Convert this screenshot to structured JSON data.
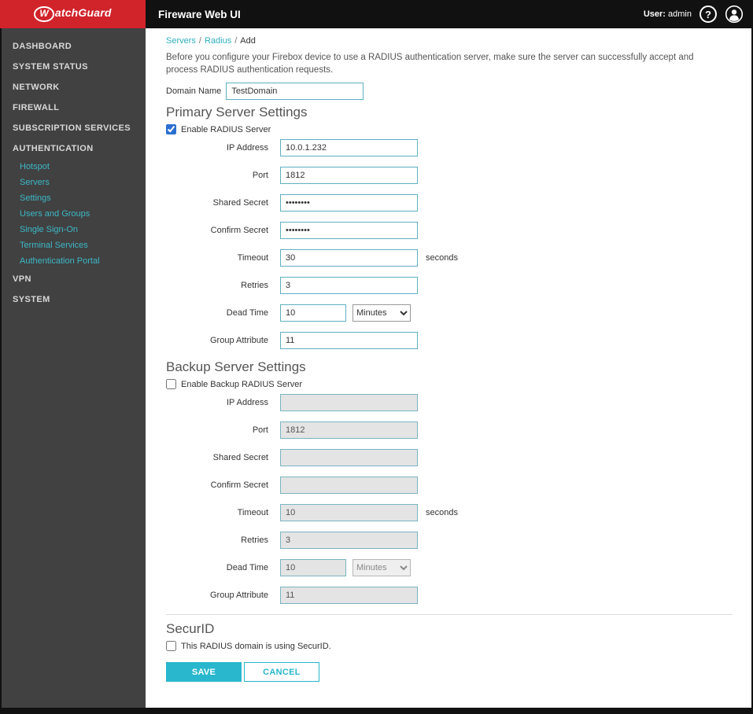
{
  "header": {
    "brand_w": "W",
    "brand_rest": "atchGuard",
    "app_title": "Fireware Web UI",
    "user_label": "User:",
    "user_name": "admin",
    "help_glyph": "?"
  },
  "sidebar": {
    "items": [
      {
        "label": "DASHBOARD"
      },
      {
        "label": "SYSTEM STATUS"
      },
      {
        "label": "NETWORK"
      },
      {
        "label": "FIREWALL"
      },
      {
        "label": "SUBSCRIPTION SERVICES"
      },
      {
        "label": "AUTHENTICATION"
      },
      {
        "label": "VPN"
      },
      {
        "label": "SYSTEM"
      }
    ],
    "authentication_subitems": [
      {
        "label": "Hotspot"
      },
      {
        "label": "Servers"
      },
      {
        "label": "Settings"
      },
      {
        "label": "Users and Groups"
      },
      {
        "label": "Single Sign-On"
      },
      {
        "label": "Terminal Services"
      },
      {
        "label": "Authentication Portal"
      }
    ]
  },
  "breadcrumb": {
    "links": [
      "Servers",
      "Radius"
    ],
    "separator": "/",
    "current": "Add"
  },
  "intro_text": "Before you configure your Firebox device to use a RADIUS authentication server, make sure the server can successfully accept and process RADIUS authentication requests.",
  "domain_name": {
    "label": "Domain Name",
    "value": "TestDomain"
  },
  "primary": {
    "title": "Primary Server Settings",
    "enable_checkbox_label": "Enable RADIUS Server",
    "enable_checked": true,
    "fields": [
      {
        "label": "IP Address",
        "value": "10.0.1.232"
      },
      {
        "label": "Port",
        "value": "1812"
      },
      {
        "label": "Shared Secret",
        "value": "••••••••"
      },
      {
        "label": "Confirm Secret",
        "value": "••••••••"
      },
      {
        "label": "Timeout",
        "value": "30",
        "suffix": "seconds"
      },
      {
        "label": "Retries",
        "value": "3"
      },
      {
        "label": "Dead Time",
        "value": "10",
        "unit": "Minutes"
      },
      {
        "label": "Group Attribute",
        "value": "11"
      }
    ]
  },
  "backup": {
    "title": "Backup Server Settings",
    "enable_checkbox_label": "Enable Backup RADIUS Server",
    "enable_checked": false,
    "fields": [
      {
        "label": "IP Address",
        "value": ""
      },
      {
        "label": "Port",
        "value": "1812"
      },
      {
        "label": "Shared Secret",
        "value": ""
      },
      {
        "label": "Confirm Secret",
        "value": ""
      },
      {
        "label": "Timeout",
        "value": "10",
        "suffix": "seconds"
      },
      {
        "label": "Retries",
        "value": "3"
      },
      {
        "label": "Dead Time",
        "value": "10",
        "unit": "Minutes"
      },
      {
        "label": "Group Attribute",
        "value": "11"
      }
    ]
  },
  "securid": {
    "title": "SecurID",
    "checkbox_label": "This RADIUS domain is using SecurID.",
    "checked": false
  },
  "actions": {
    "save": "SAVE",
    "cancel": "CANCEL"
  }
}
